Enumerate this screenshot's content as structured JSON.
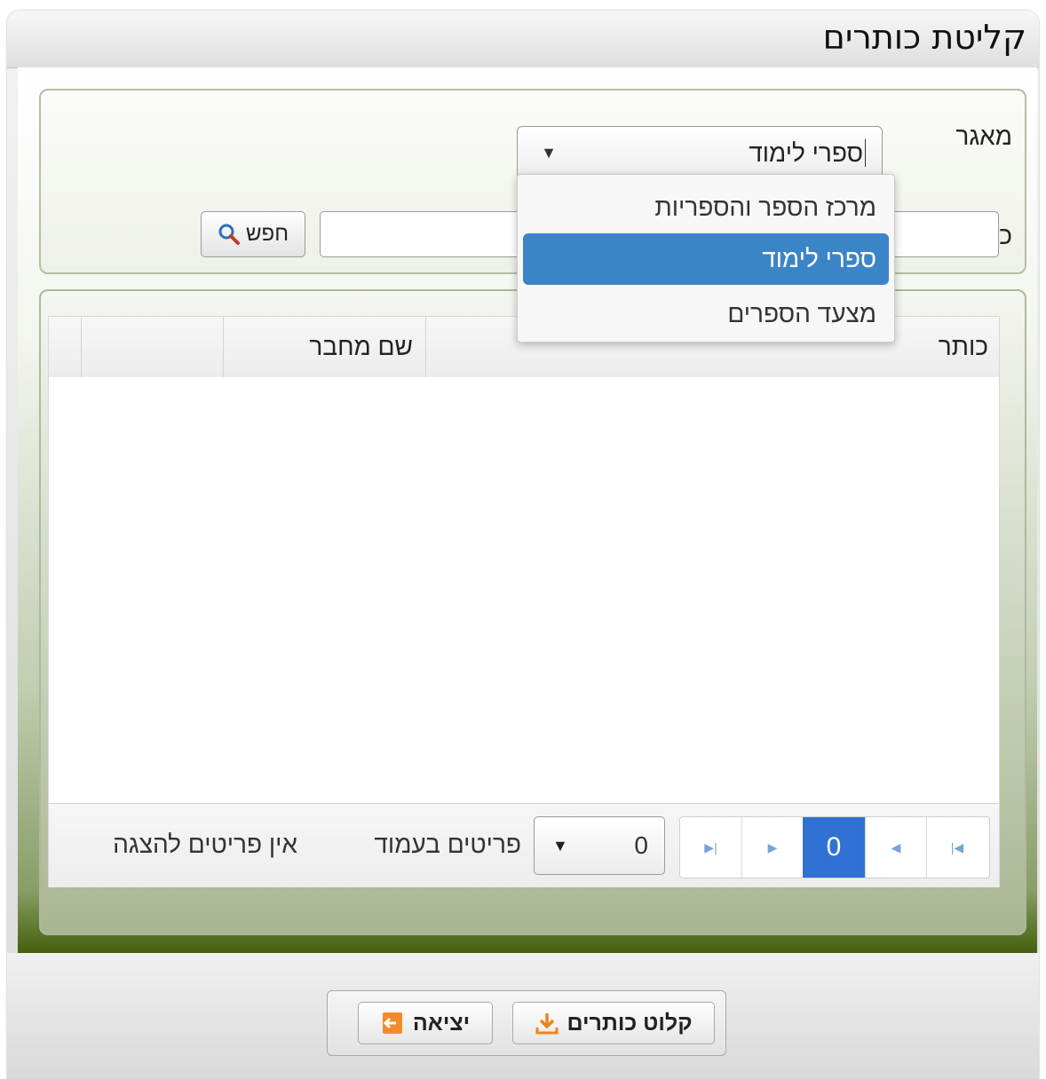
{
  "window": {
    "title": "קליטת כותרים"
  },
  "search": {
    "source_label": "מאגר",
    "source_selected": "ספרי לימוד",
    "title_label": "כותר",
    "title_value": "",
    "search_button": "חפש"
  },
  "dropdown": {
    "options": [
      {
        "label": "מרכז הספר והספריות",
        "selected": false
      },
      {
        "label": "ספרי לימוד",
        "selected": true
      },
      {
        "label": "מצעד הספרים",
        "selected": false
      }
    ]
  },
  "grid": {
    "columns": [
      "כותר",
      "שם מחבר",
      "",
      ""
    ],
    "rows": [],
    "pager": {
      "current_page": "0",
      "page_size": "0",
      "page_size_label": "פריטים בעמוד",
      "status": "אין פריטים להצגה"
    }
  },
  "actions": {
    "import_label": "קלוט כותרים",
    "exit_label": "יציאה"
  },
  "colors": {
    "accent": "#3072d4",
    "selected_option": "#3c84c8",
    "frame_green": "#44600c"
  }
}
